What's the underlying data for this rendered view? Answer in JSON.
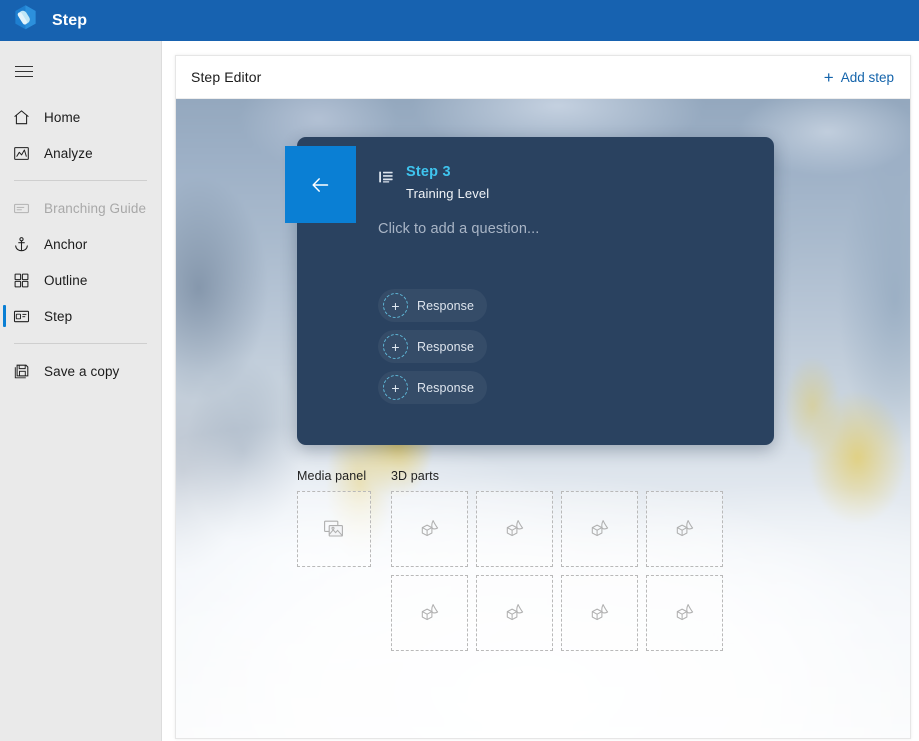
{
  "titlebar": {
    "app_name": "Step",
    "logo_icon": "hexagon-cube-logo",
    "bg_color": "#1762b0"
  },
  "sidebar": {
    "menu_toggle": {
      "icon": "hamburger-menu-icon"
    },
    "items": [
      {
        "label": "Home",
        "icon": "home-icon",
        "state": "normal"
      },
      {
        "label": "Analyze",
        "icon": "analyze-chart-icon",
        "state": "normal"
      },
      {
        "label": "Branching Guide",
        "icon": "branching-guide-icon",
        "state": "disabled"
      },
      {
        "label": "Anchor",
        "icon": "anchor-icon",
        "state": "normal"
      },
      {
        "label": "Outline",
        "icon": "outline-grid-icon",
        "state": "normal"
      },
      {
        "label": "Step",
        "icon": "step-card-icon",
        "state": "selected"
      },
      {
        "label": "Save a copy",
        "icon": "save-floppy-icon",
        "state": "normal"
      }
    ],
    "accent_color": "#0a7fd4",
    "bg_color": "#eaeaea"
  },
  "content_header": {
    "title": "Step Editor",
    "add_step": {
      "label": "Add step",
      "icon": "plus-icon",
      "glyph": "+",
      "color": "#1464ab"
    }
  },
  "step_card": {
    "back_button": {
      "icon": "arrow-left-icon",
      "color": "#0a7fd4"
    },
    "list_icon": "list-bullet-icon",
    "step_number": "Step 3",
    "step_name": "Training Level",
    "question_placeholder": "Click to add a question...",
    "card_color": "#2a4260",
    "step_number_color": "#3fc4ee",
    "responses": [
      {
        "label": "Response",
        "glyph": "+",
        "icon": "add-response-icon"
      },
      {
        "label": "Response",
        "glyph": "+",
        "icon": "add-response-icon"
      },
      {
        "label": "Response",
        "glyph": "+",
        "icon": "add-response-icon"
      }
    ]
  },
  "assets": {
    "media_panel": {
      "label": "Media panel",
      "slots": [
        {
          "icon": "media-image-icon"
        }
      ]
    },
    "parts_3d": {
      "label": "3D parts",
      "slots": [
        {
          "icon": "3d-part-icon"
        },
        {
          "icon": "3d-part-icon"
        },
        {
          "icon": "3d-part-icon"
        },
        {
          "icon": "3d-part-icon"
        },
        {
          "icon": "3d-part-icon"
        },
        {
          "icon": "3d-part-icon"
        },
        {
          "icon": "3d-part-icon"
        },
        {
          "icon": "3d-part-icon"
        }
      ]
    }
  }
}
